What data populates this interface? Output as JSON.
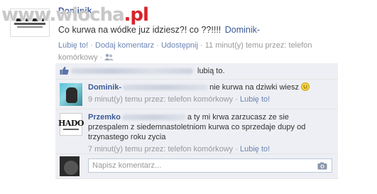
{
  "watermark": {
    "brand": "www.wiocha",
    "tld": ".pl"
  },
  "post": {
    "author_partial": "Dominik",
    "text": "Co kurwa na wódke juz idziesz?! co ??!!!! ",
    "tagged": "Dominik-",
    "actions": {
      "like": "Lubię to!",
      "comment": "Dodaj komentarz",
      "share": "Udostępnij",
      "time": "11 minut(y) temu przez: telefon komórkowy",
      "sep": "·"
    }
  },
  "likes": {
    "text": "lubią to."
  },
  "comments": [
    {
      "author": "Dominik-",
      "text": "nie kurwa na dziwki wiesz",
      "meta_time": "9 minut(y) temu przez: telefon komórkowy",
      "meta_like": "Lubię to!"
    },
    {
      "author": "Przemko",
      "avatar_text": "HADO",
      "text": "a ty mi krwa zarzucasz ze sie przespalem z siedemnastoletniom kurwa co sprzedaje dupy od trzynastego roku zycia",
      "meta_time": "7 minut(y) temu przez: telefon komórkowy",
      "meta_like": "Lubię to!"
    }
  ],
  "composer": {
    "placeholder": "Napisz komentarz..."
  },
  "colors": {
    "link": "#3b5998",
    "meta_link": "#6d84b4",
    "box_bg": "#edeff4",
    "watermark_red": "#d9222a"
  }
}
